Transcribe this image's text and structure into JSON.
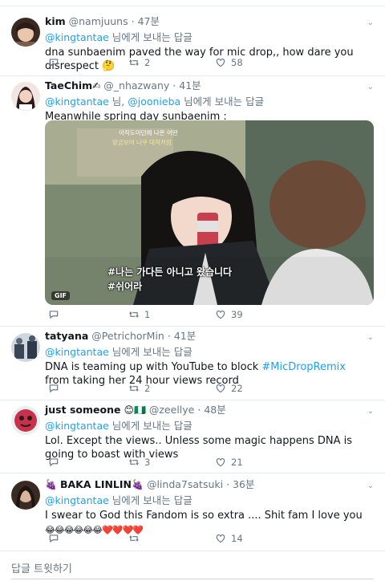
{
  "tweets": [
    {
      "name": "kim",
      "handle": "@namjuuns",
      "time": "47분",
      "reply_to": [
        "@kingtantae"
      ],
      "reply_suffix": "님에게 보내는 답글",
      "text_parts": [
        "dna sunbaenim paved the way for mic drop,, how dare you disrespect "
      ],
      "text_emoji": "🤔",
      "replies": "",
      "retweets": "2",
      "likes": "58",
      "avatar_color": "#c9a58f"
    },
    {
      "name": "TaeChim",
      "name_emoji": "✍",
      "handle": "@_nhazwany",
      "time": "41분",
      "reply_to": [
        "@kingtantae",
        "@joonieba"
      ],
      "reply_sep": " 님, ",
      "reply_suffix": "님에게 보내는 답글",
      "text_parts": [
        "Meanwhile spring day sunbaenim :"
      ],
      "media": {
        "caption_top": "아직도미던에 나온 어떤",
        "caption_top2": "방금보여 나쿠 대학처럼",
        "subtitle1": "#나는 가다든 아니고 왔습니다",
        "subtitle2": "#쉬어라",
        "badge": "GIF"
      },
      "replies": "",
      "retweets": "1",
      "likes": "39",
      "avatar_color": "#e8c0b4"
    },
    {
      "name": "tatyana",
      "handle": "@PetrichorMin",
      "time": "41분",
      "reply_to": [
        "@kingtantae"
      ],
      "reply_suffix": "님에게 보내는 답글",
      "text_parts": [
        "DNA is teaming up with YouTube to block ",
        "#MicDropRemix",
        " from taking her 24 hour views record"
      ],
      "replies": "",
      "retweets": "2",
      "likes": "22",
      "avatar_color": "#4a5868"
    },
    {
      "name": "just someone",
      "name_emoji": "😊🇳🇬",
      "handle": "@zeellye",
      "time": "48분",
      "reply_to": [
        "@kingtantae"
      ],
      "reply_suffix": "님에게 보내는 답글",
      "text_parts": [
        "Lol. Except the views.. Unless some magic happens DNA is going to boast with views"
      ],
      "replies": "",
      "retweets": "3",
      "likes": "21",
      "avatar_color": "#c7324a"
    },
    {
      "name": "BAKA LINLIN",
      "name_emoji_before": "🍇",
      "name_emoji": "🍇",
      "handle": "@linda7satsuki",
      "time": "36분",
      "reply_to": [
        "@kingtantae"
      ],
      "reply_suffix": "님에게 보내는 답글",
      "text_parts": [
        "I swear to God this Fandom is so extra .... Shit fam I love you"
      ],
      "text_line2": "😂😂😂😂😂😂❤️❤️❤️❤️",
      "replies": "",
      "retweets": "",
      "likes": "14",
      "avatar_color": "#6b4a3a"
    }
  ],
  "composer": {
    "placeholder": "답글 트윗하기"
  },
  "colors": {
    "link": "#1da1f2",
    "muted": "#657786",
    "border": "#e6ecf0"
  }
}
